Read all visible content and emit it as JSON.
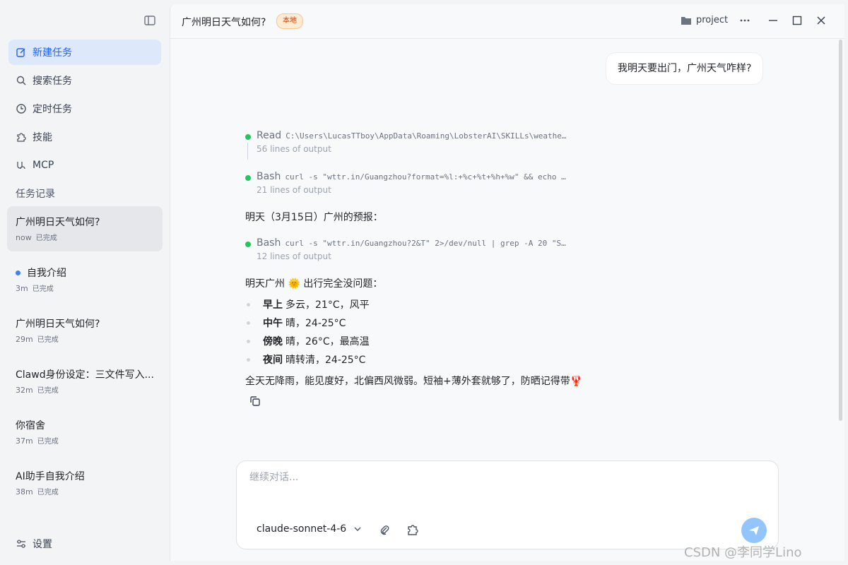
{
  "sidebar": {
    "nav": [
      {
        "label": "新建任务",
        "icon": "edit-icon"
      },
      {
        "label": "搜索任务",
        "icon": "search-icon"
      },
      {
        "label": "定时任务",
        "icon": "clock-icon"
      },
      {
        "label": "技能",
        "icon": "puzzle-icon"
      },
      {
        "label": "MCP",
        "icon": "plug-icon"
      }
    ],
    "history_label": "任务记录",
    "tasks": [
      {
        "title": "广州明日天气如何?",
        "time": "now",
        "status": "已完成"
      },
      {
        "title": "自我介绍",
        "time": "3m",
        "status": "已完成"
      },
      {
        "title": "广州明日天气如何?",
        "time": "29m",
        "status": "已完成"
      },
      {
        "title": "Clawd身份设定：三文件写入...",
        "time": "32m",
        "status": "已完成"
      },
      {
        "title": "你宿舍",
        "time": "37m",
        "status": "已完成"
      },
      {
        "title": "AI助手自我介绍",
        "time": "38m",
        "status": "已完成"
      }
    ],
    "settings_label": "设置"
  },
  "header": {
    "title": "广州明日天气如何?",
    "badge": "本地",
    "project": "project"
  },
  "chat": {
    "user_message": "我明天要出门，广州天气咋样?",
    "tools": [
      {
        "name": "Read",
        "cmd": "C:\\Users\\LucasTTboy\\AppData\\Roaming\\LobsterAI\\SKILLs\\weathe…",
        "output": "56 lines of output"
      },
      {
        "name": "Bash",
        "cmd": "curl -s \"wttr.in/Guangzhou?format=%l:+%c+%t+%h+%w\" && echo …",
        "output": "21 lines of output"
      },
      {
        "name": "Bash",
        "cmd": "curl -s \"wttr.in/Guangzhou?2&T\" 2>/dev/null | grep -A 20 \"S…",
        "output": "12 lines of output"
      }
    ],
    "forecast_intro": "明天（3月15日）广州的预报：",
    "summary_line": "明天广州 🌞 出行完全没问题：",
    "forecast": [
      {
        "period": "早上",
        "desc": "多云，21°C，风平"
      },
      {
        "period": "中午",
        "desc": "晴，24-25°C"
      },
      {
        "period": "傍晚",
        "desc": "晴，26°C，最高温"
      },
      {
        "period": "夜间",
        "desc": "晴转清，24-25°C"
      }
    ],
    "closing": "全天无降雨，能见度好，北偏西风微弱。短袖+薄外套就够了，防晒记得带🦞"
  },
  "composer": {
    "placeholder": "继续对话...",
    "model": "claude-sonnet-4-6"
  },
  "watermark": "CSDN @李同学Lino",
  "colors": {
    "accent": "#2563eb",
    "active_nav_bg": "#dde8fb",
    "tool_dot": "#22c55e",
    "badge_bg": "#fdebd3",
    "send_button": "#93c5fd"
  }
}
